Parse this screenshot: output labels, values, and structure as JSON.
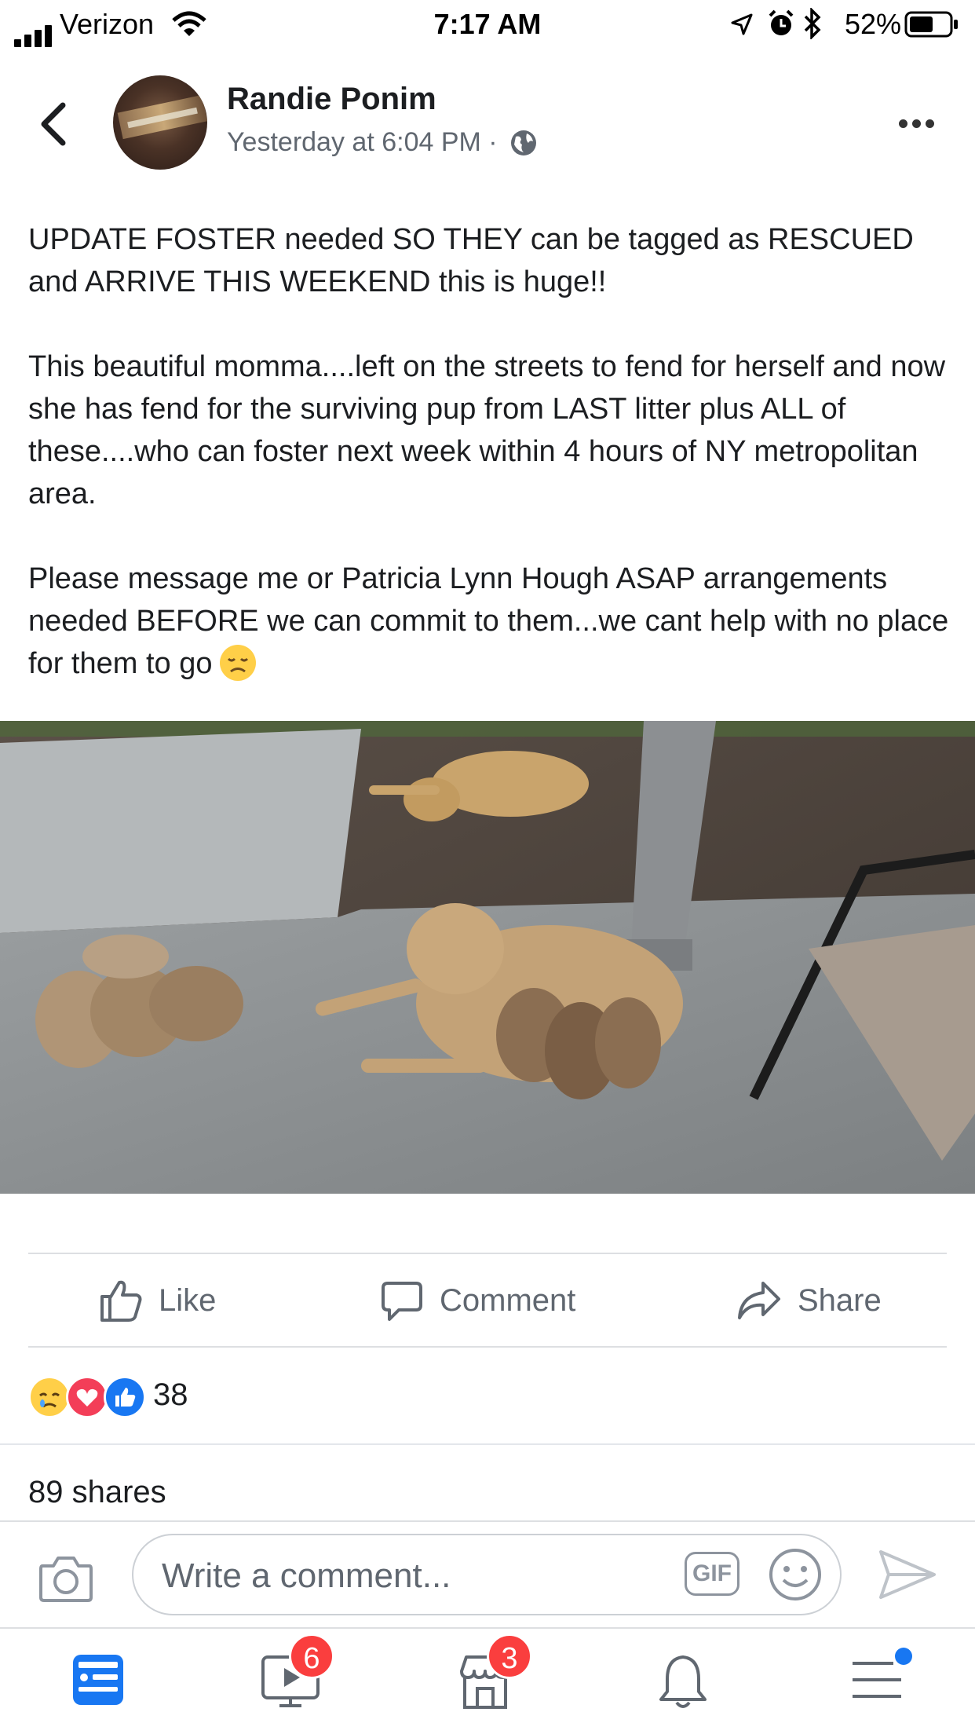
{
  "status_bar": {
    "carrier": "Verizon",
    "time": "7:17 AM",
    "battery": "52%"
  },
  "post": {
    "author": "Randie Ponim",
    "timestamp": "Yesterday at 6:04 PM ·",
    "paragraphs": [
      "UPDATE FOSTER needed SO THEY can be tagged as RESCUED and ARRIVE THIS WEEKEND this is huge!!",
      "This beautiful momma....left on the streets to fend for herself and now she has fend for the surviving pup from LAST litter plus ALL of these....who can foster next week within 4 hours of NY metropolitan area.",
      "Please message me or Patricia Lynn Hough ASAP arrangements needed BEFORE we can commit to them...we cant help with no place for them to go"
    ],
    "photo_icon": "photo-of-mother-dog-with-puppies"
  },
  "actions": {
    "like": "Like",
    "comment": "Comment",
    "share": "Share"
  },
  "engagement": {
    "reaction_icons": [
      "sad-reaction-icon",
      "love-reaction-icon",
      "like-reaction-icon"
    ],
    "reaction_count": "38",
    "shares": "89 shares"
  },
  "composer": {
    "placeholder": "Write a comment...",
    "gif_label": "GIF"
  },
  "tabbar": {
    "items": [
      {
        "name": "news-feed",
        "badge": null
      },
      {
        "name": "watch",
        "badge": "6"
      },
      {
        "name": "marketplace",
        "badge": "3"
      },
      {
        "name": "notifications",
        "badge": null
      },
      {
        "name": "menu",
        "badge": null
      }
    ]
  },
  "colors": {
    "accent": "#1877f2",
    "badge": "#fa3e3e",
    "secondary_text": "#606770"
  }
}
